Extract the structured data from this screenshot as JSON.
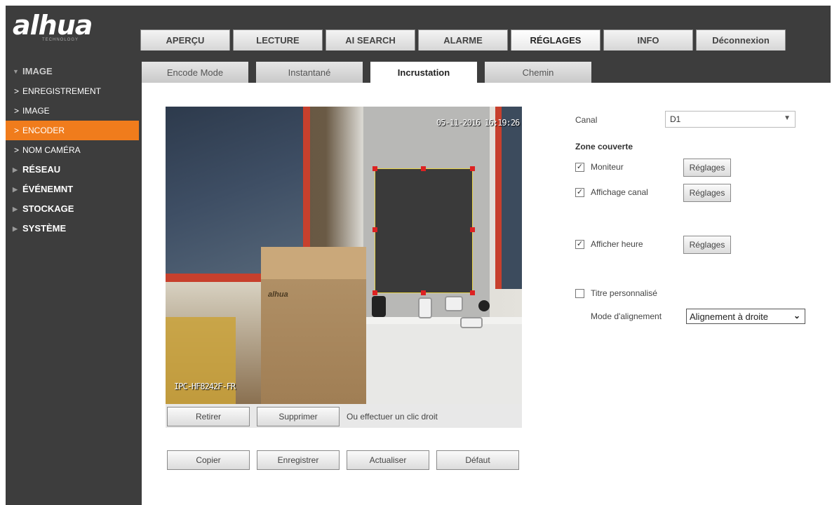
{
  "logo": {
    "name": "alhua",
    "sub": "TECHNOLOGY"
  },
  "topnav": [
    "APERÇU",
    "LECTURE",
    "AI SEARCH",
    "ALARME",
    "RÉGLAGES",
    "INFO",
    "Déconnexion"
  ],
  "topnav_active": "RÉGLAGES",
  "sidebar": {
    "image_group": "IMAGE",
    "sub_items": [
      "ENREGISTREMENT",
      "IMAGE",
      "ENCODER",
      "NOM CAMÉRA"
    ],
    "active_sub": "ENCODER",
    "groups": [
      "RÉSEAU",
      "ÉVÉNEMNT",
      "STOCKAGE",
      "SYSTÈME"
    ]
  },
  "subtabs": [
    "Encode Mode",
    "Instantané",
    "Incrustation",
    "Chemin"
  ],
  "subtab_active": "Incrustation",
  "video": {
    "timestamp": "05-11-2016 16:19:26",
    "camera_name": "IPC-HF8242F-FR",
    "brand_on_box": "alhua"
  },
  "video_bar": {
    "retirer": "Retirer",
    "supprimer": "Supprimer",
    "hint": "Ou effectuer un clic droit"
  },
  "actions": {
    "copier": "Copier",
    "enregistrer": "Enregistrer",
    "actualiser": "Actualiser",
    "defaut": "Défaut"
  },
  "settings": {
    "canal_label": "Canal",
    "canal_value": "D1",
    "zone_label": "Zone couverte",
    "moniteur": {
      "label": "Moniteur",
      "checked": true,
      "button": "Réglages"
    },
    "affichage_canal": {
      "label": "Affichage canal",
      "checked": true,
      "button": "Réglages"
    },
    "afficher_heure": {
      "label": "Afficher heure",
      "checked": true,
      "button": "Réglages"
    },
    "titre_perso": {
      "label": "Titre personnalisé",
      "checked": false
    },
    "alignment_label": "Mode d'alignement",
    "alignment_value": "Alignement à droite"
  },
  "colors": {
    "accent": "#f07c1c",
    "sidebar_bg": "#3d3d3d",
    "mask_border": "#e8d44a",
    "handle": "#dd2222"
  }
}
